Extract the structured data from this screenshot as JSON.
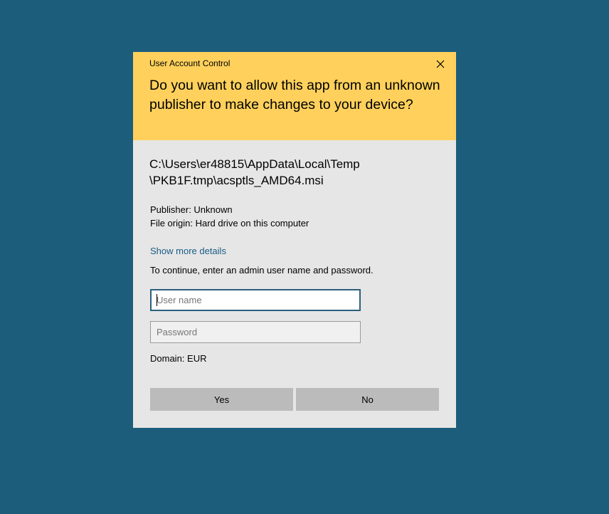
{
  "dialog": {
    "title": "User Account Control",
    "question": "Do you want to allow this app from an unknown publisher to make changes to your device?",
    "file_path_line1": "C:\\Users\\er48815\\AppData\\Local\\Temp",
    "file_path_line2": "\\PKB1F.tmp\\acsptls_AMD64.msi",
    "publisher": "Publisher: Unknown",
    "file_origin": "File origin: Hard drive on this computer",
    "show_details": "Show more details",
    "instruction": "To continue, enter an admin user name and password.",
    "username_placeholder": "User name",
    "username_value": "",
    "password_placeholder": "Password",
    "password_value": "",
    "domain": "Domain: EUR",
    "yes_label": "Yes",
    "no_label": "No",
    "close_icon": "close-icon"
  },
  "colors": {
    "desktop": "#1c5d7c",
    "header": "#ffd15c",
    "body": "#e6e6e6",
    "link": "#1a5c86",
    "button": "#bbbbbb"
  }
}
